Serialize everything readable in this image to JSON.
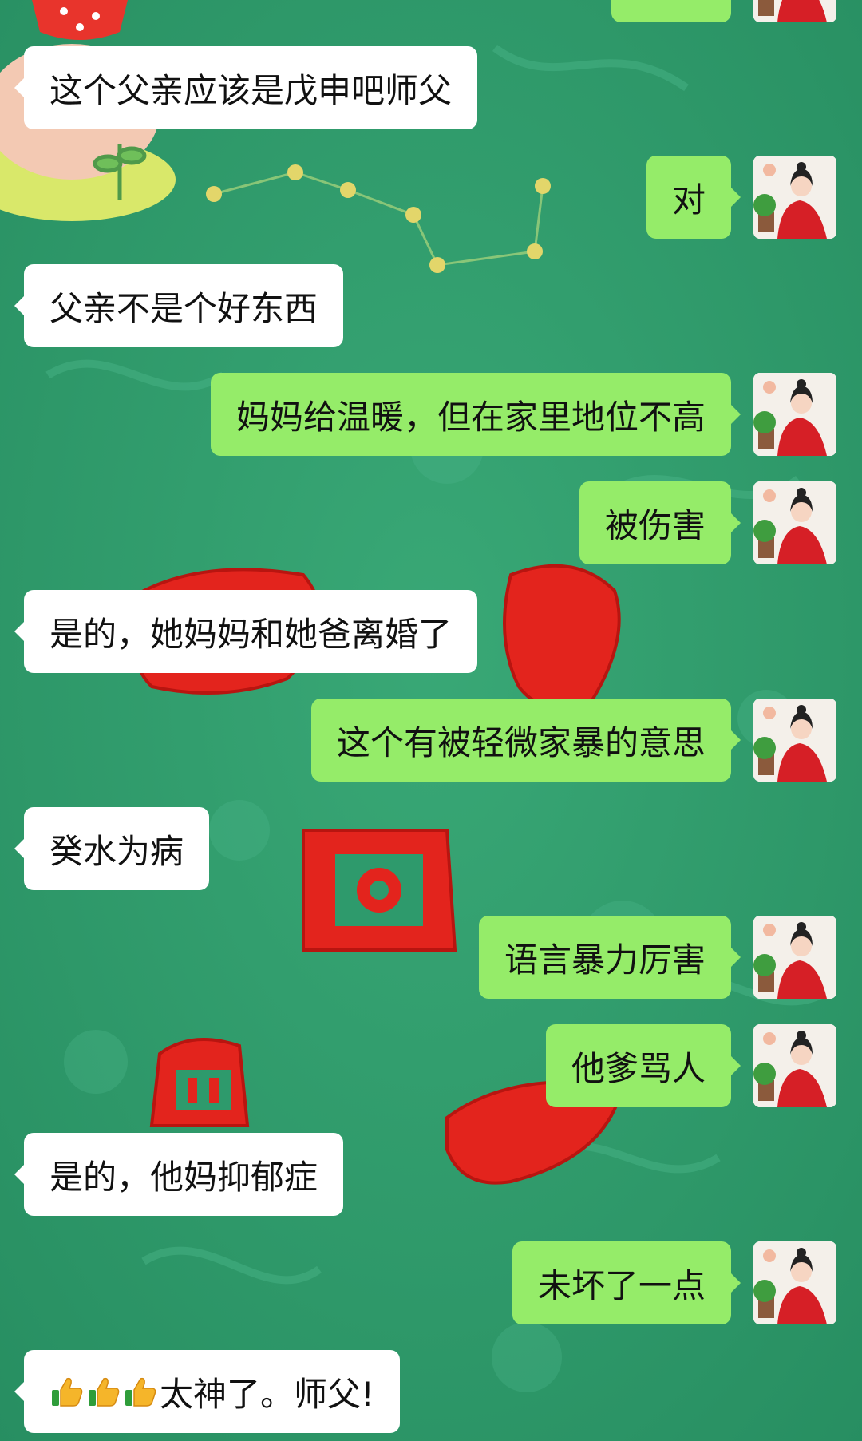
{
  "chat": {
    "messages": [
      {
        "side": "out",
        "text": ""
      },
      {
        "side": "in",
        "text": "这个父亲应该是戊申吧师父"
      },
      {
        "side": "out",
        "text": "对"
      },
      {
        "side": "in",
        "text": "父亲不是个好东西"
      },
      {
        "side": "out",
        "text": "妈妈给温暖，但在家里地位不高"
      },
      {
        "side": "out",
        "text": "被伤害"
      },
      {
        "side": "in",
        "text": "是的，她妈妈和她爸离婚了"
      },
      {
        "side": "out",
        "text": "这个有被轻微家暴的意思"
      },
      {
        "side": "in",
        "text": "癸水为病"
      },
      {
        "side": "out",
        "text": "语言暴力厉害"
      },
      {
        "side": "out",
        "text": "他爹骂人"
      },
      {
        "side": "in",
        "text": "是的，他妈抑郁症"
      },
      {
        "side": "out",
        "text": "未坏了一点"
      },
      {
        "side": "in",
        "text": "太神了。师父!",
        "prefix_icons": [
          "thumbs-up-icon",
          "thumbs-up-icon",
          "thumbs-up-icon"
        ]
      }
    ]
  },
  "colors": {
    "background": "#2e9a6c",
    "incoming_bubble": "#ffffff",
    "outgoing_bubble": "#95ec69",
    "text": "#111111"
  },
  "icons": {
    "avatar": "woman-red-hanfu-avatar",
    "thumb": "thumbs-up-icon"
  }
}
